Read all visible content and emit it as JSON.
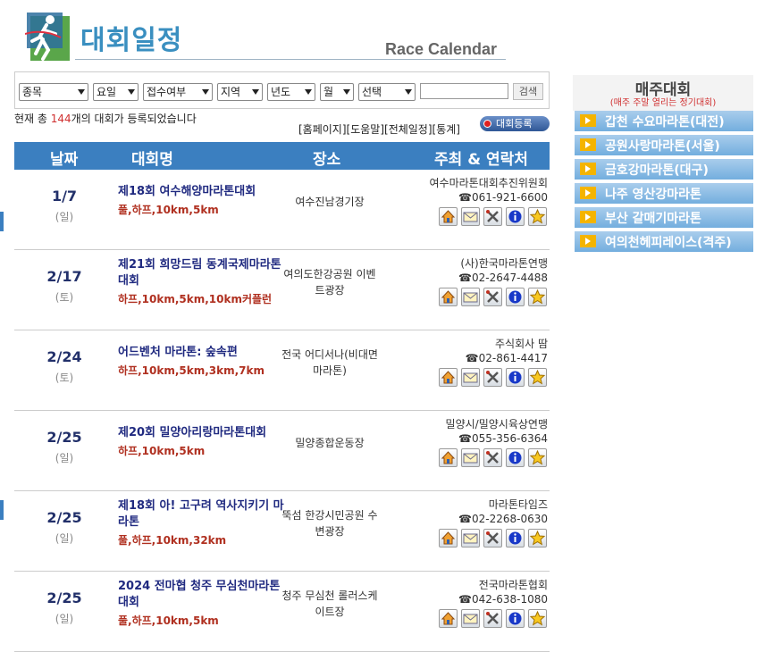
{
  "header": {
    "title_ko": "대회일정",
    "title_en": "Race Calendar"
  },
  "filters": {
    "selects": [
      "종목",
      "요일",
      "접수여부",
      "지역",
      "년도",
      "월",
      "선택"
    ],
    "search_value": "",
    "search_button": "검색"
  },
  "summary": {
    "prefix": "현재 총 ",
    "count": "144",
    "suffix": "개의 대회가 등록되었습니다"
  },
  "links": {
    "text": "[홈페이지][도움말][전체일정][통계]",
    "register": "대회등록"
  },
  "table": {
    "headers": [
      "날짜",
      "대회명",
      "장소",
      "주최 & 연락처"
    ],
    "rows": [
      {
        "date": "1/7",
        "dow": "(일)",
        "name": "제18회 여수해양마라톤대회",
        "courses": "풀,하프,10km,5km",
        "place": "여수진남경기장",
        "organizer": "여수마라톤대회추진위원회",
        "phone": "☎061-921-6600"
      },
      {
        "date": "2/17",
        "dow": "(토)",
        "name": "제21회 희망드림 동계국제마라톤대회",
        "courses": "하프,10km,5km,10km커플런",
        "place": "여의도한강공원 이벤트광장",
        "organizer": "(사)한국마라톤연맹",
        "phone": "☎02-2647-4488"
      },
      {
        "date": "2/24",
        "dow": "(토)",
        "name": "어드벤처 마라톤: 숲속편",
        "courses": "하프,10km,5km,3km,7km",
        "place": "전국 어디서나(비대면 마라톤)",
        "organizer": "주식회사 땀",
        "phone": "☎02-861-4417"
      },
      {
        "date": "2/25",
        "dow": "(일)",
        "name": "제20회 밀양아리랑마라톤대회",
        "courses": "하프,10km,5km",
        "place": "밀양종합운동장",
        "organizer": "밀양시/밀양시육상연맹",
        "phone": "☎055-356-6364"
      },
      {
        "date": "2/25",
        "dow": "(일)",
        "name": "제18회 아! 고구려 역사지키기 마라톤",
        "courses": "풀,하프,10km,32km",
        "place": "뚝섬 한강시민공원 수변광장",
        "organizer": "마라톤타임즈",
        "phone": "☎02-2268-0630"
      },
      {
        "date": "2/25",
        "dow": "(일)",
        "name": "2024 전마협 청주 무심천마라톤대회",
        "courses": "풀,하프,10km,5km",
        "place": "청주 무심천 롤러스케이트장",
        "organizer": "전국마라톤협회",
        "phone": "☎042-638-1080"
      }
    ],
    "row_icons": [
      "home-icon",
      "mail-icon",
      "tools-icon",
      "info-icon",
      "star-icon"
    ]
  },
  "sidebar": {
    "title": "매주대회",
    "subtitle": "(매주 주말 열리는 정기대회)",
    "items": [
      "갑천 수요마라톤(대전)",
      "공원사랑마라톤(서울)",
      "금호강마라톤(대구)",
      "나주 영산강마라톤",
      "부산 갈매기마라톤",
      "여의천헤피레이스(격주)"
    ]
  },
  "colors": {
    "accent": "#3b7fc0",
    "title": "#3a8fc0",
    "race_name": "#202a80",
    "courses": "#b03020",
    "count": "#d03030",
    "sidebar_item": "#73aede"
  }
}
